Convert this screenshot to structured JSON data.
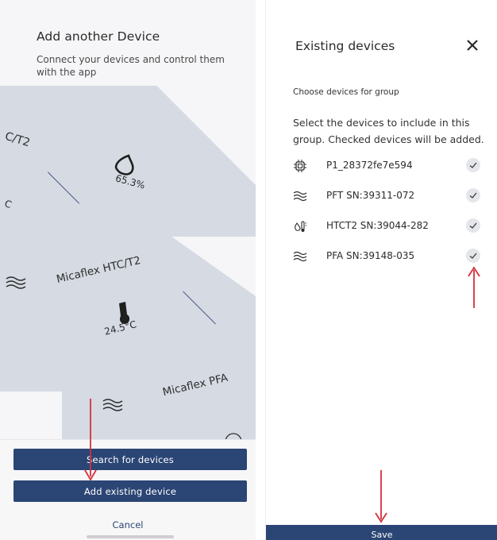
{
  "left": {
    "title": "Add another Device",
    "subtitle": "Connect your devices and control them with the app",
    "cards": {
      "top_name": "C/T2",
      "top_reading": "65.3%",
      "top_partial_unit": "C",
      "middle_name": "Micaflex HTC/T2",
      "middle_reading": "24.5°C",
      "bottom_name": "Micaflex PFA"
    },
    "buttons": {
      "search": "Search for devices",
      "add_existing": "Add existing device",
      "cancel": "Cancel"
    }
  },
  "right": {
    "title": "Existing devices",
    "section_label": "Choose devices for group",
    "description": "Select the devices to include in this group. Checked devices will be added.",
    "devices": [
      {
        "label": "P1_28372fe7e594",
        "icon": "chip-icon",
        "checked": true
      },
      {
        "label": "PFT SN:39311-072",
        "icon": "airflow-icon",
        "checked": true
      },
      {
        "label": "HTCT2 SN:39044-282",
        "icon": "humidity-temp-icon",
        "checked": true
      },
      {
        "label": "PFA SN:39148-035",
        "icon": "airflow-icon",
        "checked": true
      }
    ],
    "save": "Save"
  },
  "colors": {
    "primary": "#2b4574",
    "card": "#d5dae3",
    "annotation_arrow": "#d4303a",
    "check_bg": "#e4e6ea"
  }
}
